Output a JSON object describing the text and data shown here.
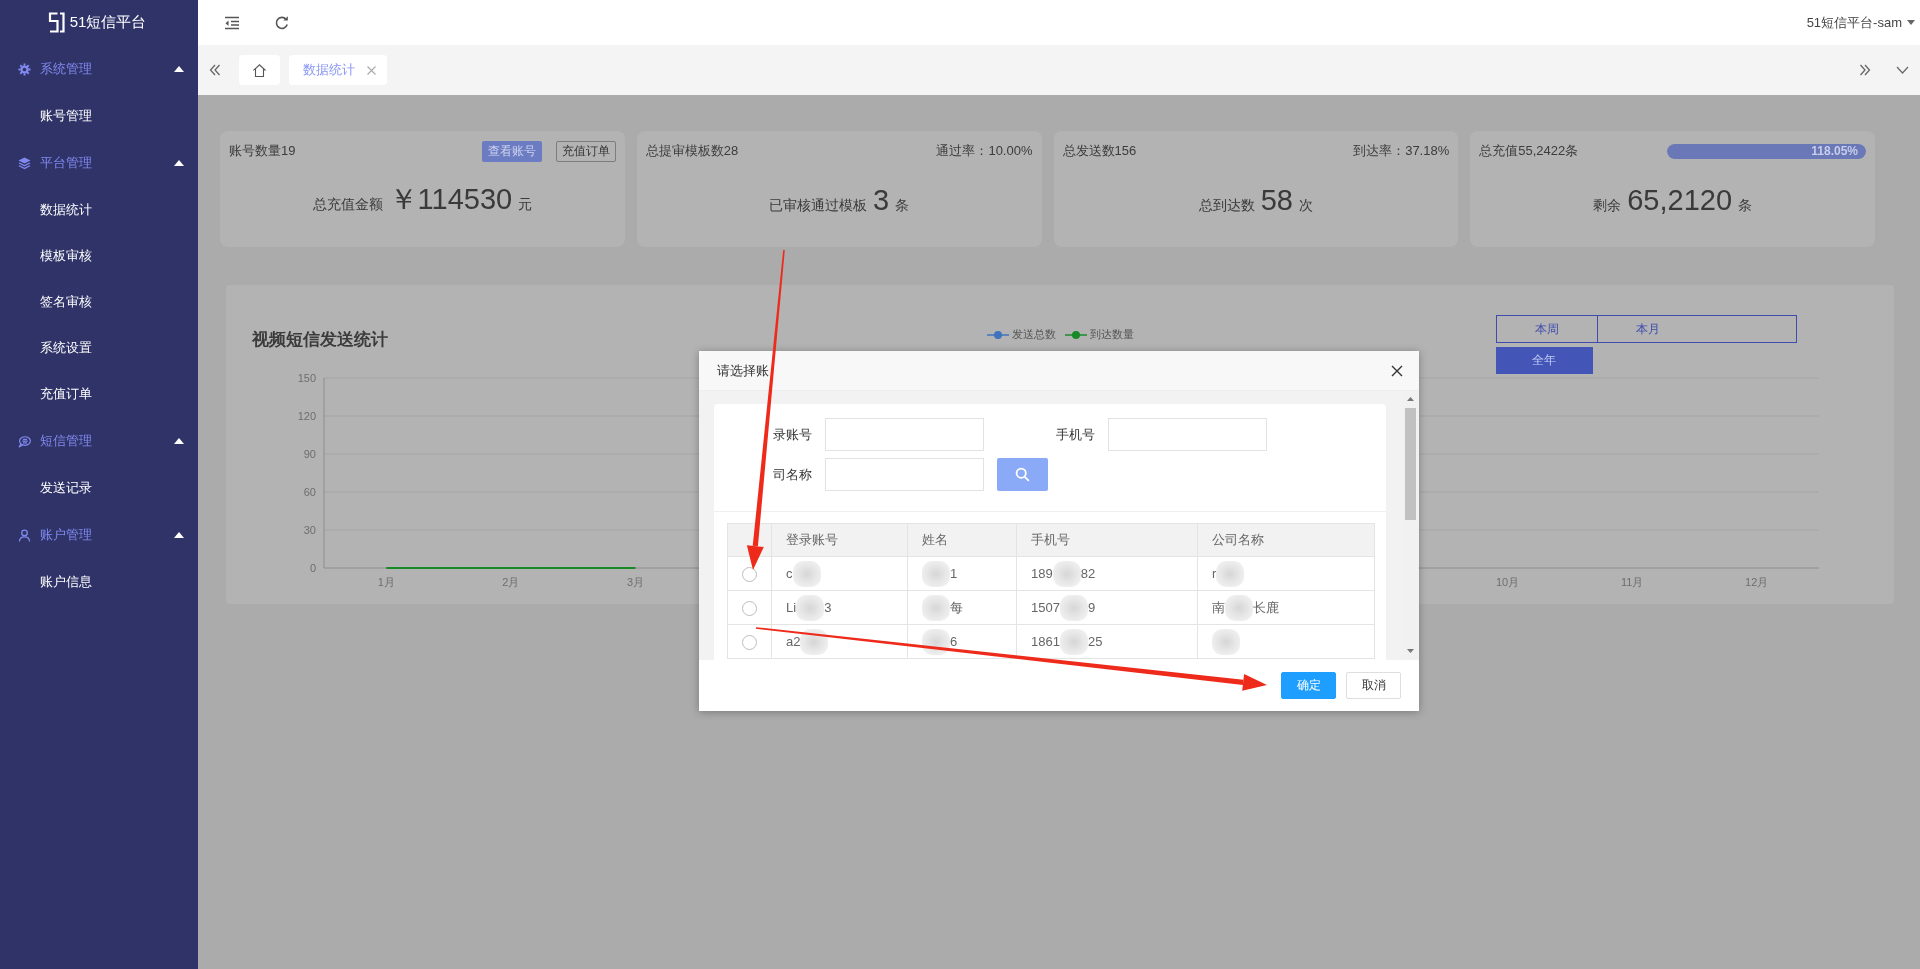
{
  "sidebar": {
    "logo": "51短信平台",
    "groups": [
      {
        "label": "系统管理",
        "expanded": true,
        "items": [
          "账号管理"
        ]
      },
      {
        "label": "平台管理",
        "expanded": true,
        "items": [
          "数据统计",
          "模板审核",
          "签名审核",
          "系统设置",
          "充值订单"
        ]
      },
      {
        "label": "短信管理",
        "expanded": true,
        "items": [
          "发送记录"
        ]
      },
      {
        "label": "账户管理",
        "expanded": true,
        "items": [
          "账户信息"
        ]
      }
    ]
  },
  "top_bar": {
    "user": "51短信平台-sam"
  },
  "tabs": [
    {
      "kind": "home",
      "selected": false
    },
    {
      "kind": "page",
      "label": "数据统计",
      "selected": true,
      "closable": true
    }
  ],
  "stats": [
    {
      "kind": "actions",
      "title": "账号数量19",
      "actions": [
        {
          "label": "查看账号",
          "kind": "primary"
        },
        {
          "label": "充值订单",
          "kind": "outline"
        }
      ],
      "prefix": "总充值金额",
      "value": "￥114530",
      "unit": "元"
    },
    {
      "kind": "rate",
      "title": "总提审模板数28",
      "rate": "通过率：10.00%",
      "prefix": "已审核通过模板",
      "value": "3",
      "unit": "条"
    },
    {
      "kind": "rate",
      "title": "总发送数156",
      "rate": "到达率：37.18%",
      "prefix": "总到达数",
      "value": "58",
      "unit": "次"
    },
    {
      "kind": "progress",
      "title": "总充值55,2422条",
      "progress": {
        "level": 1,
        "label": "118.05%"
      },
      "prefix": "剩余",
      "value": "65,2120",
      "unit": "条"
    }
  ],
  "chart_panel": {
    "title": "视频短信发送统计",
    "ranges": [
      {
        "label": "本周",
        "selected": false
      },
      {
        "label": "本月",
        "selected": false
      },
      {
        "label": "全年",
        "selected": true
      }
    ],
    "chart_data": {
      "type": "line",
      "grid": true,
      "categories": [
        "1月",
        "2月",
        "3月",
        null,
        null,
        null,
        null,
        null,
        null,
        "10月",
        "11月",
        "12月"
      ],
      "ylim": [
        0,
        150
      ],
      "yticks": [
        0,
        30,
        60,
        90,
        120,
        150
      ],
      "series": [
        {
          "name": "发送总数",
          "color": "#3f74bd",
          "values": [
            null,
            null,
            null,
            null,
            null,
            null,
            null,
            null,
            null,
            null,
            null,
            null
          ]
        },
        {
          "name": "到达数量",
          "color": "#178a28",
          "values": [
            0,
            0,
            0,
            null,
            null,
            null,
            null,
            null,
            null,
            null,
            null,
            null
          ]
        }
      ]
    }
  },
  "dialog": {
    "title": "请选择账",
    "filters": [
      {
        "label": "录账号"
      },
      {
        "label": "手机号"
      },
      {
        "label": "司名称"
      }
    ],
    "table": {
      "columns": [
        "登录账号",
        "姓名",
        "手机号",
        "公司名称"
      ],
      "rows": [
        {
          "selected": false,
          "cells": [
            {
              "head": "c",
              "redacted": true
            },
            {
              "tail": "1",
              "redacted": true
            },
            {
              "head": "189",
              "tail": "82",
              "redacted": true
            },
            {
              "head": "r",
              "redacted": true
            }
          ]
        },
        {
          "selected": false,
          "cells": [
            {
              "head": "Li",
              "tail": "3",
              "redacted": true
            },
            {
              "tail": "每",
              "redacted": true
            },
            {
              "head": "1507",
              "tail": "9",
              "redacted": true
            },
            {
              "head": "南",
              "tail": "长鹿",
              "redacted": true
            }
          ]
        },
        {
          "selected": false,
          "cells": [
            {
              "head": "a2",
              "redacted": true
            },
            {
              "tail": "6",
              "redacted": true
            },
            {
              "head": "1861",
              "tail": "25",
              "redacted": true
            },
            {
              "redacted": true
            }
          ]
        }
      ]
    },
    "buttons": [
      {
        "label": "确定",
        "kind": "primary"
      },
      {
        "label": "取消",
        "kind": "default"
      }
    ]
  }
}
